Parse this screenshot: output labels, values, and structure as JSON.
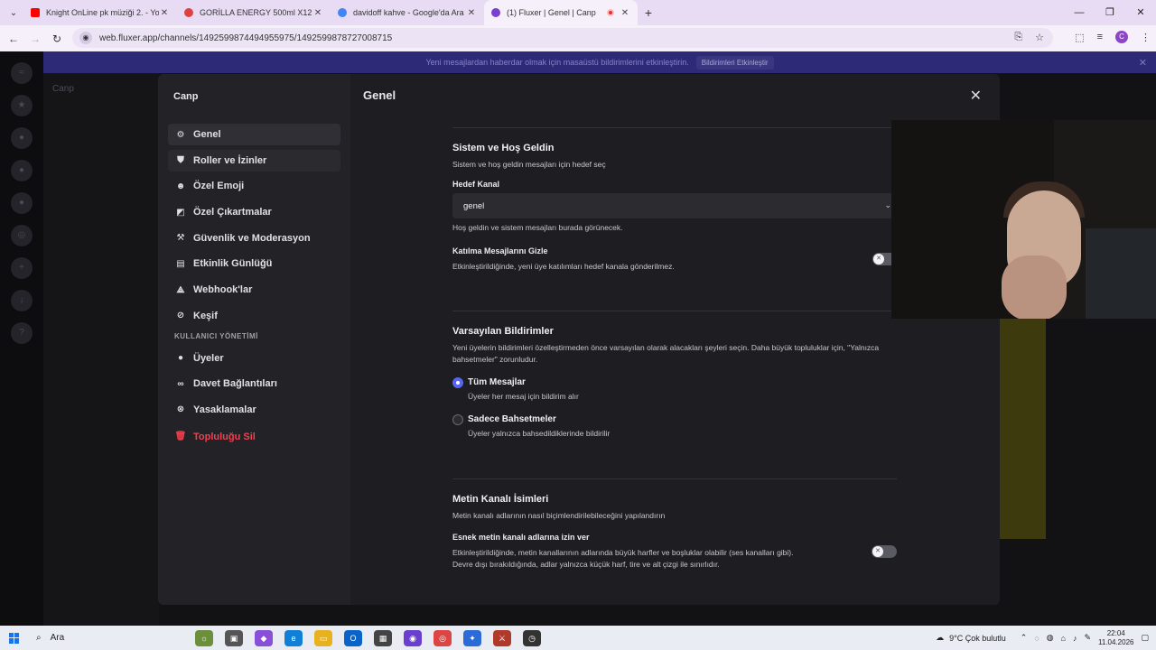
{
  "browser": {
    "tabs": [
      {
        "label": "Knight OnLine pk müziği 2. - Yo",
        "color": "#ff0000"
      },
      {
        "label": "GORİLLA ENERGY 500ml X12 En",
        "color": "#e04040"
      },
      {
        "label": "davidoff kahve - Google'da Ara",
        "color": "#4285f4"
      },
      {
        "label": "(1) Fluxer | Genel | Canp",
        "color": "#7a3fd0"
      }
    ],
    "url": "web.fluxer.app/channels/1492599874494955975/1492599878727008715",
    "profile_initial": "C"
  },
  "background": {
    "banner_text": "Yeni mesajlardan haberdar olmak için masaüstü bildirimlerini etkinleştirin.",
    "banner_button": "Bildirimleri Etkinleştir",
    "server_name": "Canp"
  },
  "modal": {
    "server_title": "Canp",
    "nav": [
      {
        "label": "Genel",
        "icon": "gear-icon"
      },
      {
        "label": "Roller ve İzinler",
        "icon": "shield-icon"
      },
      {
        "label": "Özel Emoji",
        "icon": "smiley-icon"
      },
      {
        "label": "Özel Çıkartmalar",
        "icon": "sticker-icon"
      },
      {
        "label": "Güvenlik ve Moderasyon",
        "icon": "hammer-icon"
      },
      {
        "label": "Etkinlik Günlüğü",
        "icon": "book-icon"
      },
      {
        "label": "Webhook'lar",
        "icon": "webhook-icon"
      },
      {
        "label": "Keşif",
        "icon": "compass-icon"
      }
    ],
    "user_section_title": "KULLANICI YÖNETİMİ",
    "user_nav": [
      {
        "label": "Üyeler",
        "icon": "person-icon"
      },
      {
        "label": "Davet Bağlantıları",
        "icon": "link-icon"
      },
      {
        "label": "Yasaklamalar",
        "icon": "ban-icon"
      }
    ],
    "delete_label": "Topluluğu Sil",
    "content_title": "Genel",
    "system": {
      "title": "Sistem ve Hoş Geldin",
      "desc": "Sistem ve hoş geldin mesajları için hedef seç",
      "target_label": "Hedef Kanal",
      "target_value": "genel",
      "target_note": "Hoş geldin ve sistem mesajları burada görünecek.",
      "hide_join_title": "Katılma Mesajlarını Gizle",
      "hide_join_desc": "Etkinleştirildiğinde, yeni üye katılımları hedef kanala gönderilmez."
    },
    "notifications": {
      "title": "Varsayılan Bildirimler",
      "desc": "Yeni üyelerin bildirimleri özelleştirmeden önce varsayılan olarak alacakları şeyleri seçin. Daha büyük topluluklar için, \"Yalnızca bahsetmeler\" zorunludur.",
      "opt1_title": "Tüm Mesajlar",
      "opt1_desc": "Üyeler her mesaj için bildirim alır",
      "opt2_title": "Sadece Bahsetmeler",
      "opt2_desc": "Üyeler yalnızca bahsedildiklerinde bildirilir"
    },
    "text_channels": {
      "title": "Metin Kanalı İsimleri",
      "desc": "Metin kanalı adlarının nasıl biçimlendirilebileceğini yapılandırın",
      "flex_title": "Esnek metin kanalı adlarına izin ver",
      "flex_desc1": "Etkinleştirildiğinde, metin kanallarının adlarında büyük harfler ve boşluklar olabilir (ses kanalları gibi).",
      "flex_desc2": "Devre dışı bırakıldığında, adlar yalnızca küçük harf, tire ve alt çizgi ile sınırlıdır."
    }
  },
  "taskbar": {
    "search_label": "Ara",
    "weather": "9°C  Çok bulutlu",
    "time": "22:04",
    "date": "11.04.2026"
  }
}
